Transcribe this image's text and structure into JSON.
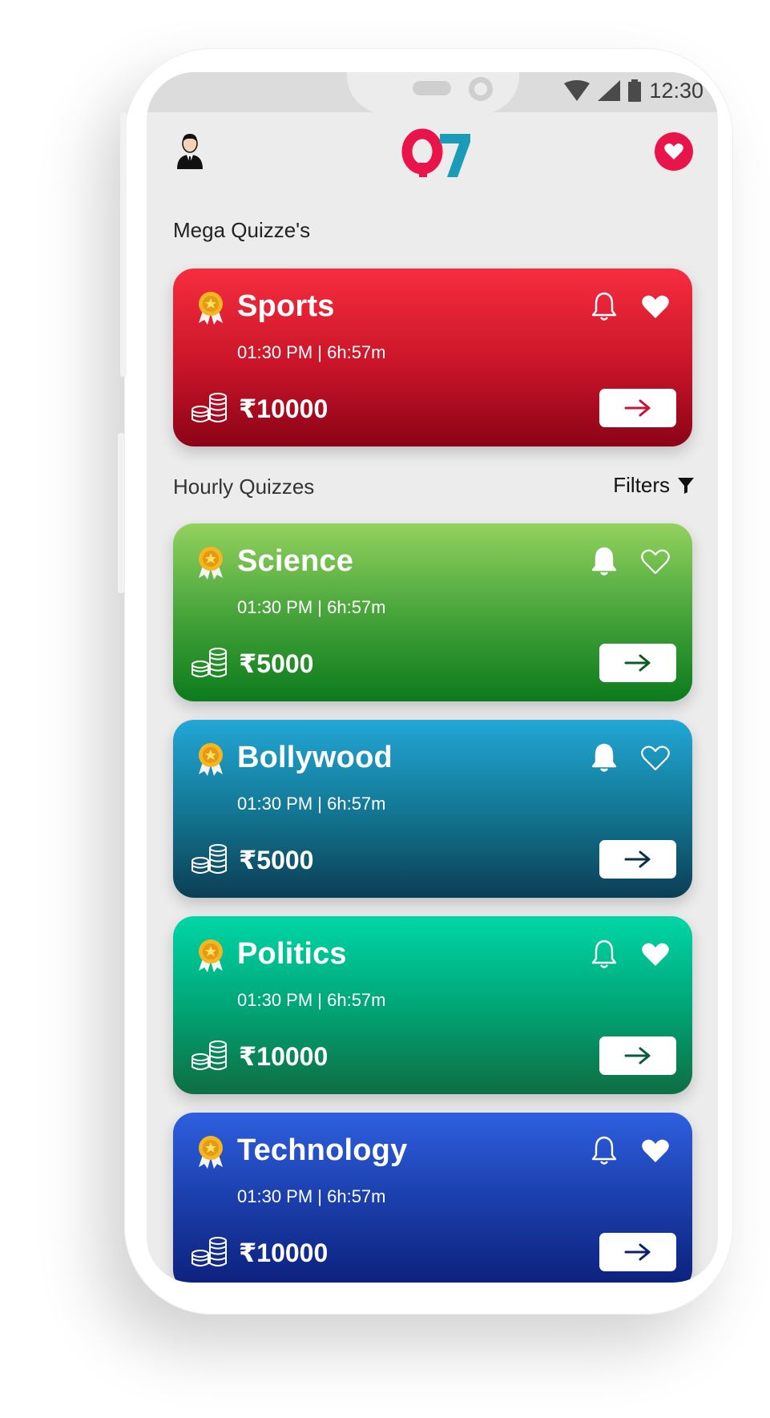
{
  "status": {
    "time": "12:30"
  },
  "header": {
    "logo_text": "Q7"
  },
  "sections": {
    "mega": "Mega Quizze's",
    "hourly": "Hourly Quizzes",
    "filters": "Filters"
  },
  "cards": [
    {
      "name": "Sports",
      "time": "01:30 PM  |  6h:57m",
      "prize": "₹10000",
      "bell": "outline",
      "heart": "filled"
    },
    {
      "name": "Science",
      "time": "01:30 PM  |  6h:57m",
      "prize": "₹5000",
      "bell": "filled",
      "heart": "outline"
    },
    {
      "name": "Bollywood",
      "time": "01:30 PM  |  6h:57m",
      "prize": "₹5000",
      "bell": "filled",
      "heart": "outline"
    },
    {
      "name": "Politics",
      "time": "01:30 PM  |  6h:57m",
      "prize": "₹10000",
      "bell": "outline",
      "heart": "filled"
    },
    {
      "name": "Technology",
      "time": "01:30 PM  |  6h:57m",
      "prize": "₹10000",
      "bell": "outline",
      "heart": "filled"
    }
  ],
  "colors": {
    "accent": "#e8144a",
    "logo_q": "#e8144a",
    "logo_7": "#1a9bb8"
  }
}
